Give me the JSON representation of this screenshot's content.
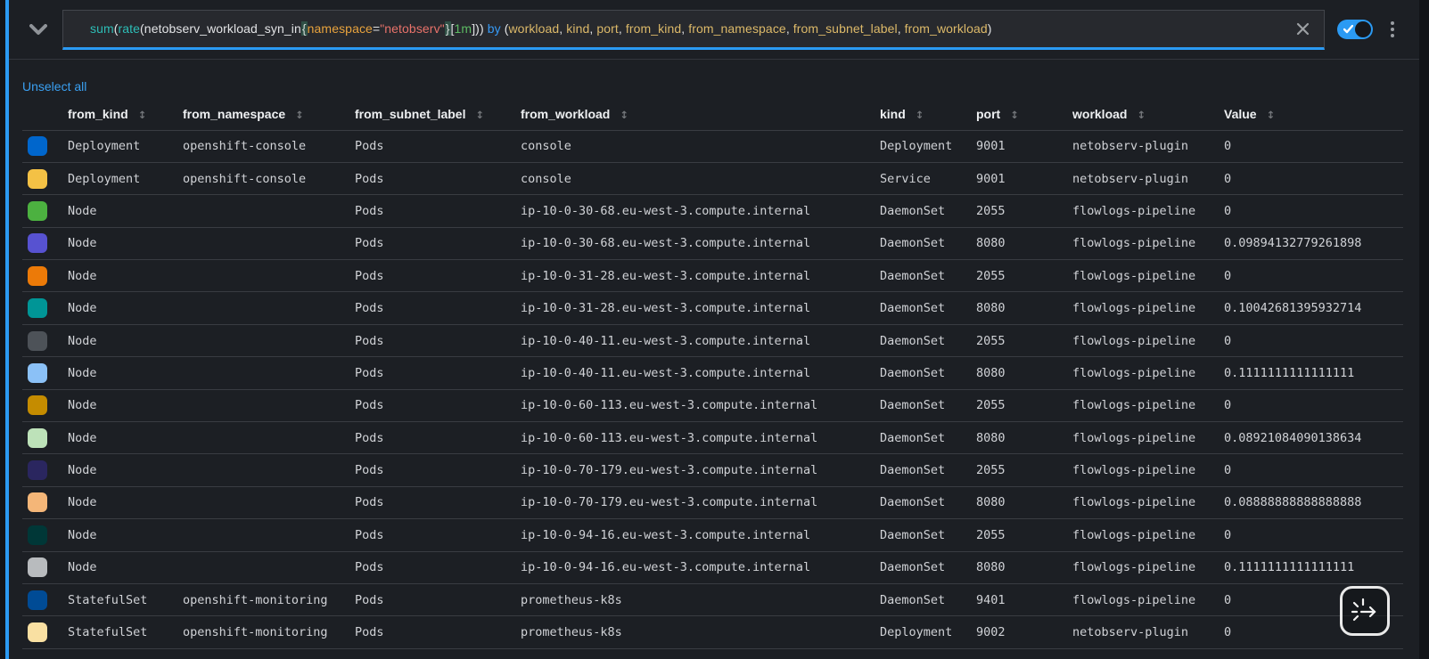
{
  "query_bar": {
    "expression": "sum(rate(netobserv_workload_syn_in{namespace=\"netobserv\"}[1m])) by (workload, kind, port, from_kind, from_namespace, from_subnet_label, from_workload)",
    "segments": [
      {
        "t": "sum",
        "c": "fn"
      },
      {
        "t": "(",
        "c": "p"
      },
      {
        "t": "rate",
        "c": "fn"
      },
      {
        "t": "(netobserv_workload_syn_in",
        "c": "p"
      },
      {
        "t": "{",
        "c": "brace"
      },
      {
        "t": "namespace",
        "c": "lbl"
      },
      {
        "t": "=",
        "c": "p"
      },
      {
        "t": "\"netobserv\"",
        "c": "str"
      },
      {
        "t": "}",
        "c": "brace"
      },
      {
        "t": "[",
        "c": "p"
      },
      {
        "t": "1m",
        "c": "dur"
      },
      {
        "t": "])) ",
        "c": "p"
      },
      {
        "t": "by",
        "c": "kw"
      },
      {
        "t": " (",
        "c": "p"
      },
      {
        "t": "workload",
        "c": "grp"
      },
      {
        "t": ", ",
        "c": "p"
      },
      {
        "t": "kind",
        "c": "grp"
      },
      {
        "t": ", ",
        "c": "p"
      },
      {
        "t": "port",
        "c": "grp"
      },
      {
        "t": ", ",
        "c": "p"
      },
      {
        "t": "from_kind",
        "c": "grp"
      },
      {
        "t": ", ",
        "c": "p"
      },
      {
        "t": "from_namespace",
        "c": "grp"
      },
      {
        "t": ", ",
        "c": "p"
      },
      {
        "t": "from_subnet_label",
        "c": "grp"
      },
      {
        "t": ", ",
        "c": "p"
      },
      {
        "t": "from_workload",
        "c": "grp"
      },
      {
        "t": ")",
        "c": "p"
      }
    ],
    "syntax_colors": {
      "fn": "#2dbdb6",
      "p": "#e2e3e5",
      "brace": "#cfd8d3",
      "lbl": "#e8a33d",
      "str": "#e8726a",
      "dur": "#5dbb63",
      "kw": "#379af5",
      "grp": "#dcb969",
      "brace_bg": "#2f4f45"
    },
    "toggle_on": true,
    "accent_color": "#2b9af3"
  },
  "series_controls": {
    "unselect_all_label": "Unselect all"
  },
  "table": {
    "columns": [
      {
        "label": "from_kind"
      },
      {
        "label": "from_namespace"
      },
      {
        "label": "from_subnet_label"
      },
      {
        "label": "from_workload"
      },
      {
        "label": "kind"
      },
      {
        "label": "port"
      },
      {
        "label": "workload"
      },
      {
        "label": "Value"
      }
    ],
    "sort_icon": "↕",
    "rows": [
      {
        "color": "#0066CC",
        "cells": [
          "Deployment",
          "openshift-console",
          "Pods",
          "console",
          "Deployment",
          "9001",
          "netobserv-plugin",
          "0"
        ]
      },
      {
        "color": "#F4C145",
        "cells": [
          "Deployment",
          "openshift-console",
          "Pods",
          "console",
          "Service",
          "9001",
          "netobserv-plugin",
          "0"
        ]
      },
      {
        "color": "#4CB140",
        "cells": [
          "Node",
          "",
          "Pods",
          "ip-10-0-30-68.eu-west-3.compute.internal",
          "DaemonSet",
          "2055",
          "flowlogs-pipeline",
          "0"
        ]
      },
      {
        "color": "#5752D1",
        "cells": [
          "Node",
          "",
          "Pods",
          "ip-10-0-30-68.eu-west-3.compute.internal",
          "DaemonSet",
          "8080",
          "flowlogs-pipeline",
          "0.09894132779261898"
        ]
      },
      {
        "color": "#EC7A08",
        "cells": [
          "Node",
          "",
          "Pods",
          "ip-10-0-31-28.eu-west-3.compute.internal",
          "DaemonSet",
          "2055",
          "flowlogs-pipeline",
          "0"
        ]
      },
      {
        "color": "#009596",
        "cells": [
          "Node",
          "",
          "Pods",
          "ip-10-0-31-28.eu-west-3.compute.internal",
          "DaemonSet",
          "8080",
          "flowlogs-pipeline",
          "0.10042681395932714"
        ]
      },
      {
        "color": "#4D5258",
        "cells": [
          "Node",
          "",
          "Pods",
          "ip-10-0-40-11.eu-west-3.compute.internal",
          "DaemonSet",
          "2055",
          "flowlogs-pipeline",
          "0"
        ]
      },
      {
        "color": "#8BC1F7",
        "cells": [
          "Node",
          "",
          "Pods",
          "ip-10-0-40-11.eu-west-3.compute.internal",
          "DaemonSet",
          "8080",
          "flowlogs-pipeline",
          "0.1111111111111111"
        ]
      },
      {
        "color": "#C58C00",
        "cells": [
          "Node",
          "",
          "Pods",
          "ip-10-0-60-113.eu-west-3.compute.internal",
          "DaemonSet",
          "2055",
          "flowlogs-pipeline",
          "0"
        ]
      },
      {
        "color": "#BDE2B9",
        "cells": [
          "Node",
          "",
          "Pods",
          "ip-10-0-60-113.eu-west-3.compute.internal",
          "DaemonSet",
          "8080",
          "flowlogs-pipeline",
          "0.08921084090138634"
        ]
      },
      {
        "color": "#2A265F",
        "cells": [
          "Node",
          "",
          "Pods",
          "ip-10-0-70-179.eu-west-3.compute.internal",
          "DaemonSet",
          "2055",
          "flowlogs-pipeline",
          "0"
        ]
      },
      {
        "color": "#F4B678",
        "cells": [
          "Node",
          "",
          "Pods",
          "ip-10-0-70-179.eu-west-3.compute.internal",
          "DaemonSet",
          "8080",
          "flowlogs-pipeline",
          "0.08888888888888888"
        ]
      },
      {
        "color": "#003737",
        "cells": [
          "Node",
          "",
          "Pods",
          "ip-10-0-94-16.eu-west-3.compute.internal",
          "DaemonSet",
          "2055",
          "flowlogs-pipeline",
          "0"
        ]
      },
      {
        "color": "#B8BBBE",
        "cells": [
          "Node",
          "",
          "Pods",
          "ip-10-0-94-16.eu-west-3.compute.internal",
          "DaemonSet",
          "8080",
          "flowlogs-pipeline",
          "0.1111111111111111"
        ]
      },
      {
        "color": "#004B95",
        "cells": [
          "StatefulSet",
          "openshift-monitoring",
          "Pods",
          "prometheus-k8s",
          "DaemonSet",
          "9401",
          "flowlogs-pipeline",
          "0"
        ]
      },
      {
        "color": "#F9E0A2",
        "cells": [
          "StatefulSet",
          "openshift-monitoring",
          "Pods",
          "prometheus-k8s",
          "Deployment",
          "9002",
          "netobserv-plugin",
          "0"
        ]
      }
    ]
  }
}
